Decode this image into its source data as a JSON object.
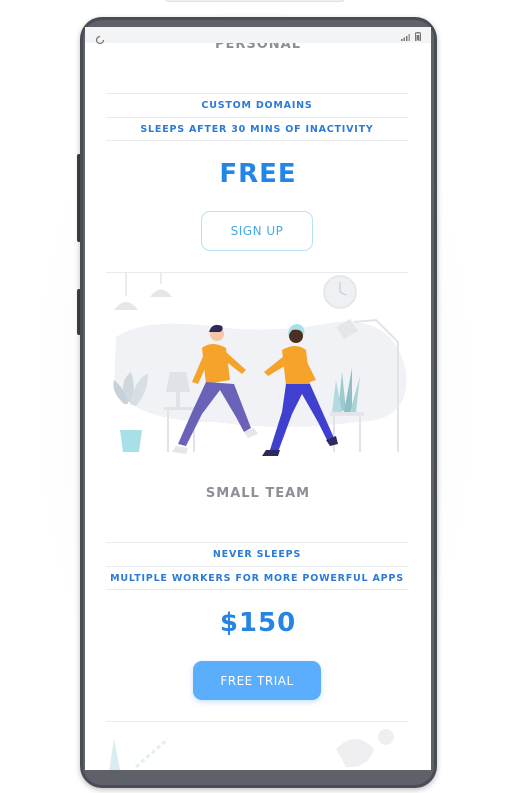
{
  "plans": [
    {
      "name": "PERSONAL",
      "features": [
        "CUSTOM DOMAINS",
        "SLEEPS AFTER 30 MINS OF INACTIVITY"
      ],
      "price": "FREE",
      "button_label": "SIGN UP"
    },
    {
      "name": "SMALL TEAM",
      "features": [
        "NEVER SLEEPS",
        "MULTIPLE WORKERS FOR MORE POWERFUL APPS"
      ],
      "price": "$150",
      "button_label": "FREE TRIAL"
    }
  ],
  "icons": {
    "status_left": "loading-icon",
    "status_signal": "signal-icon",
    "status_battery": "battery-icon"
  },
  "colors": {
    "accent": "#2585e6",
    "button_filled": "#5aaefc",
    "button_outline_border": "#b7e4f4",
    "feature_text": "#2b7ad8",
    "jacket": "#f5a32a",
    "pants": "#3f3fd0"
  }
}
